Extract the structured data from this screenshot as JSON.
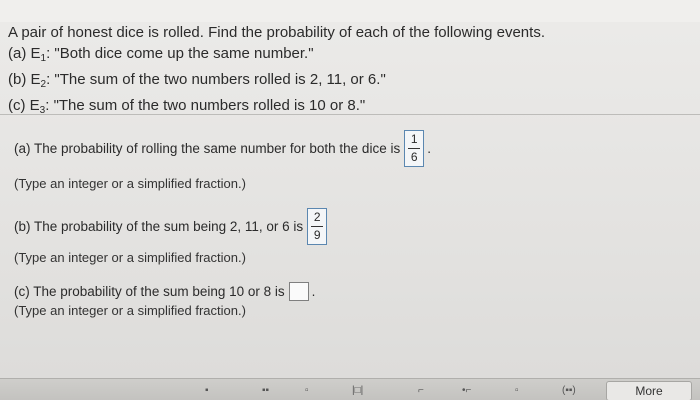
{
  "problem": {
    "intro": "A pair of honest dice is rolled. Find the probability of each of the following events.",
    "events": [
      {
        "prefix": "(a) E",
        "sub": "1",
        "text": ": \"Both dice come up the same number.\""
      },
      {
        "prefix": "(b) E",
        "sub": "2",
        "text": ": \"The sum of the two numbers rolled is 2, 11, or 6.\""
      },
      {
        "prefix": "(c) E",
        "sub": "3",
        "text": ": \"The sum of the two numbers rolled is 10 or 8.\""
      }
    ]
  },
  "questions": {
    "a": {
      "text": "(a) The probability of rolling the same number for both the dice is",
      "numerator": "1",
      "denominator": "6",
      "end": ".",
      "hint": "(Type an integer or a simplified fraction.)"
    },
    "b": {
      "text": "(b) The probability of the sum being 2, 11, or 6 is",
      "numerator": "2",
      "denominator": "9",
      "hint": "(Type an integer or a simplified fraction.)"
    },
    "c": {
      "text": "(c) The probability of the sum being 10 or 8 is",
      "end": ".",
      "hint": "(Type an integer or a simplified fraction.)"
    }
  },
  "toolbar": {
    "tools": [
      "▪",
      "▪▪",
      "▫",
      "|□|",
      "⌐",
      "•⌐",
      "▫",
      "(▪▪)"
    ],
    "more_label": "More"
  }
}
